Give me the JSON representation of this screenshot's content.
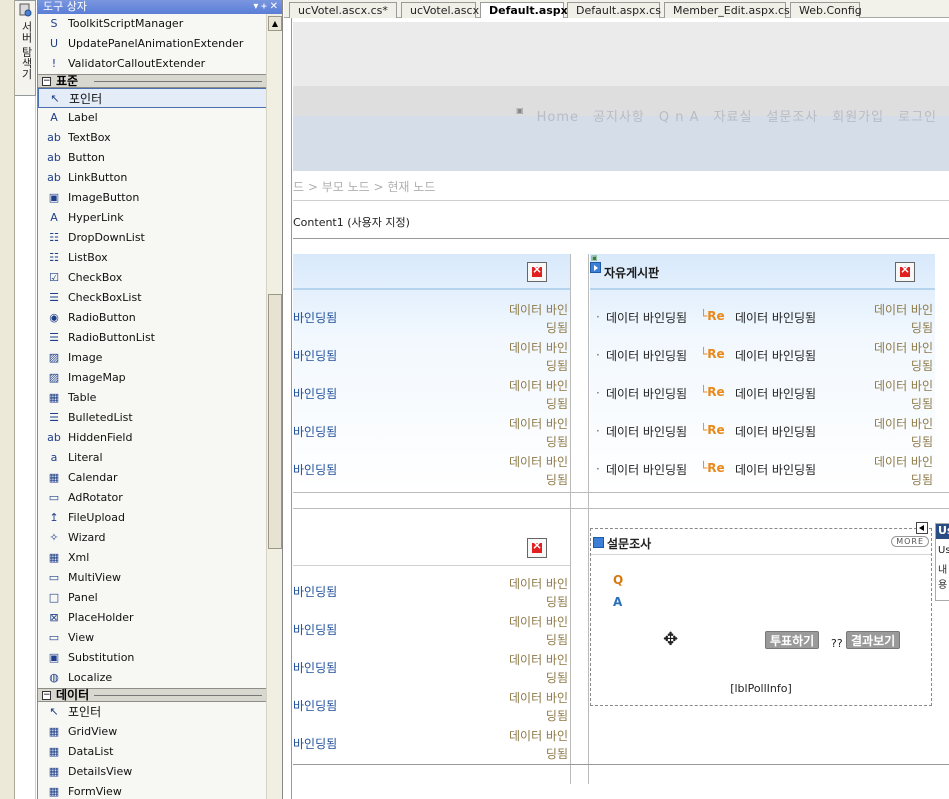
{
  "server_explorer_tab": {
    "label": "서버 탐색기"
  },
  "toolbox": {
    "title": "도구 상자",
    "window_controls": "▾ ᚐ ✕",
    "top_items": [
      {
        "icon": "S",
        "label": "ToolkitScriptManager"
      },
      {
        "icon": "U",
        "label": "UpdatePanelAnimationExtender"
      },
      {
        "icon": "!",
        "label": "ValidatorCalloutExtender"
      }
    ],
    "group_standard": "표준",
    "standard_items": [
      {
        "icon": "↖",
        "label": "포인터",
        "selected": true
      },
      {
        "icon": "A",
        "label": "Label"
      },
      {
        "icon": "ab",
        "label": "TextBox"
      },
      {
        "icon": "ab",
        "label": "Button"
      },
      {
        "icon": "ab",
        "label": "LinkButton"
      },
      {
        "icon": "▣",
        "label": "ImageButton"
      },
      {
        "icon": "A",
        "label": "HyperLink"
      },
      {
        "icon": "☷",
        "label": "DropDownList"
      },
      {
        "icon": "☷",
        "label": "ListBox"
      },
      {
        "icon": "☑",
        "label": "CheckBox"
      },
      {
        "icon": "☰",
        "label": "CheckBoxList"
      },
      {
        "icon": "◉",
        "label": "RadioButton"
      },
      {
        "icon": "☰",
        "label": "RadioButtonList"
      },
      {
        "icon": "▨",
        "label": "Image"
      },
      {
        "icon": "▨",
        "label": "ImageMap"
      },
      {
        "icon": "▦",
        "label": "Table"
      },
      {
        "icon": "☰",
        "label": "BulletedList"
      },
      {
        "icon": "ab",
        "label": "HiddenField"
      },
      {
        "icon": "a",
        "label": "Literal"
      },
      {
        "icon": "▦",
        "label": "Calendar"
      },
      {
        "icon": "▭",
        "label": "AdRotator"
      },
      {
        "icon": "↥",
        "label": "FileUpload"
      },
      {
        "icon": "✧",
        "label": "Wizard"
      },
      {
        "icon": "▦",
        "label": "Xml"
      },
      {
        "icon": "▭",
        "label": "MultiView"
      },
      {
        "icon": "□",
        "label": "Panel"
      },
      {
        "icon": "⊠",
        "label": "PlaceHolder"
      },
      {
        "icon": "▭",
        "label": "View"
      },
      {
        "icon": "▣",
        "label": "Substitution"
      },
      {
        "icon": "◍",
        "label": "Localize"
      }
    ],
    "group_data": "데이터",
    "data_items": [
      {
        "icon": "↖",
        "label": "포인터"
      },
      {
        "icon": "▦",
        "label": "GridView"
      },
      {
        "icon": "▦",
        "label": "DataList"
      },
      {
        "icon": "▦",
        "label": "DetailsView"
      },
      {
        "icon": "▦",
        "label": "FormView"
      }
    ]
  },
  "tabs": [
    {
      "label": "ucVotel.ascx.cs*"
    },
    {
      "label": "ucVotel.ascx"
    },
    {
      "label": "Default.aspx*",
      "active": true
    },
    {
      "label": "Default.aspx.cs"
    },
    {
      "label": "Member_Edit.aspx.cs"
    },
    {
      "label": "Web.Config"
    }
  ],
  "page": {
    "nav_items": [
      "Home",
      "공지사항",
      "Q n A",
      "자료실",
      "설문조사",
      "회원가입",
      "로그인"
    ],
    "breadcrumb": "드 > 부모 노드 > 현재 노드",
    "content_label": "Content1 (사용자 지정)",
    "board_right_title": "자유게시판",
    "row_text": "데이터 바인딩됨",
    "row_re": "└Re",
    "row_date_1": "데이터 바인",
    "row_date_2": "딩됨",
    "row_left_trunc": "바인딩됨",
    "survey": {
      "title": "설문조사",
      "more": "MORE",
      "q": "Q",
      "a": "A",
      "vote_button": "투표하기",
      "result_button": "결과보기",
      "qq": "??",
      "label": "[lblPollInfo]"
    },
    "side_popup": {
      "header": "Us",
      "line1": "Use",
      "line2": "내용"
    }
  },
  "colors": {
    "selection_accent": "#4a6fb0",
    "title_blue": "#5a7ed6",
    "re_orange": "#e8891a",
    "date_brown": "#8d7a48"
  }
}
